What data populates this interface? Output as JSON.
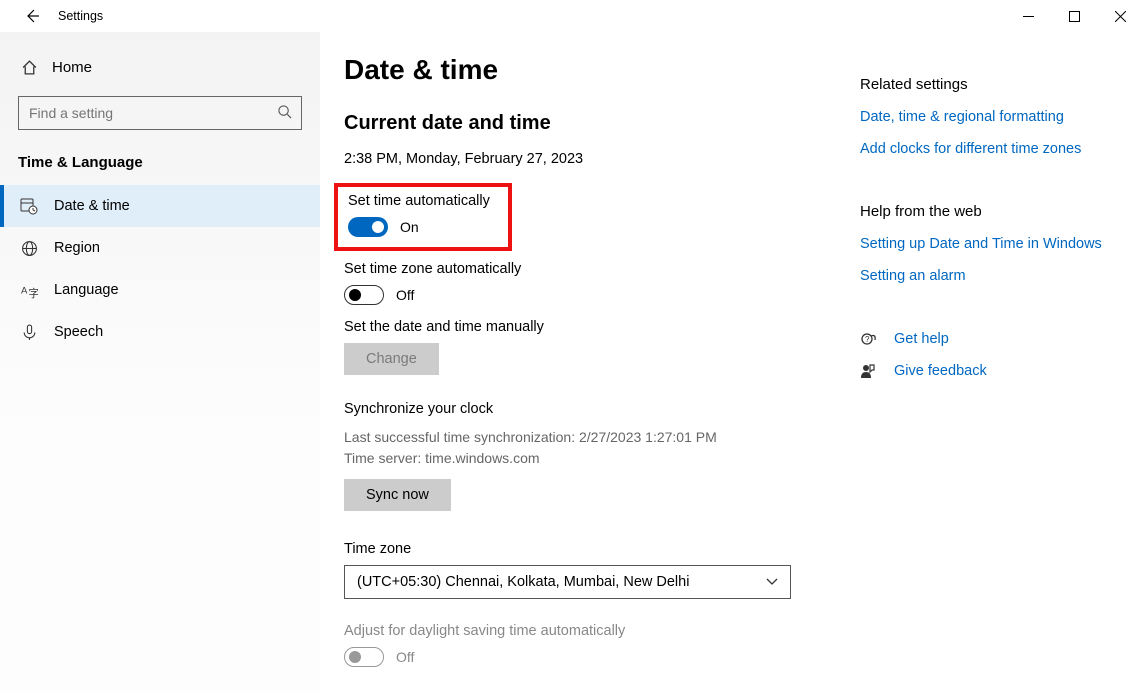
{
  "titlebar": {
    "app_title": "Settings"
  },
  "sidebar": {
    "home": "Home",
    "search_placeholder": "Find a setting",
    "section": "Time & Language",
    "items": [
      {
        "label": "Date & time",
        "active": true
      },
      {
        "label": "Region"
      },
      {
        "label": "Language"
      },
      {
        "label": "Speech"
      }
    ]
  },
  "page": {
    "title": "Date & time",
    "current_heading": "Current date and time",
    "current_value": "2:38 PM, Monday, February 27, 2023",
    "set_time_auto": {
      "label": "Set time automatically",
      "state": "On"
    },
    "set_zone_auto": {
      "label": "Set time zone automatically",
      "state": "Off"
    },
    "manual": {
      "label": "Set the date and time manually",
      "button": "Change"
    },
    "sync": {
      "heading": "Synchronize your clock",
      "last": "Last successful time synchronization: 2/27/2023 1:27:01 PM",
      "server": "Time server: time.windows.com",
      "button": "Sync now"
    },
    "timezone": {
      "label": "Time zone",
      "value": "(UTC+05:30) Chennai, Kolkata, Mumbai, New Delhi"
    },
    "dst": {
      "label": "Adjust for daylight saving time automatically",
      "state": "Off"
    }
  },
  "right": {
    "related_heading": "Related settings",
    "link1": "Date, time & regional formatting",
    "link2": "Add clocks for different time zones",
    "help_heading": "Help from the web",
    "help_link1": "Setting up Date and Time in Windows",
    "help_link2": "Setting an alarm",
    "get_help": "Get help",
    "feedback": "Give feedback"
  }
}
